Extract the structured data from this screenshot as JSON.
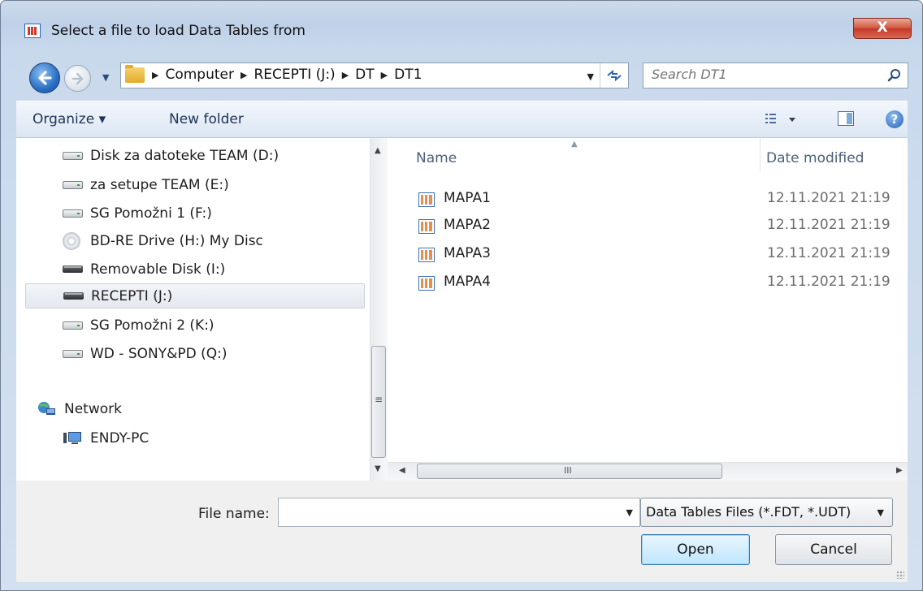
{
  "window": {
    "title": "Select a file to load Data Tables from",
    "close_label": "X"
  },
  "address": {
    "crumbs": [
      "Computer",
      "RECEPTI (J:)",
      "DT",
      "DT1"
    ]
  },
  "search": {
    "placeholder": "Search DT1"
  },
  "commands": {
    "organize": "Organize ▾",
    "new_folder": "New folder"
  },
  "nav": {
    "items": [
      {
        "label": "Disk za datoteke TEAM (D:)",
        "icon": "hard-drive-icon"
      },
      {
        "label": "za setupe TEAM (E:)",
        "icon": "hard-drive-icon"
      },
      {
        "label": "SG Pomožni 1 (F:)",
        "icon": "hard-drive-icon"
      },
      {
        "label": "BD-RE Drive (H:) My Disc",
        "icon": "disc-drive-icon"
      },
      {
        "label": "Removable Disk (I:)",
        "icon": "removable-disk-icon"
      },
      {
        "label": "RECEPTI (J:)",
        "icon": "removable-disk-icon",
        "selected": true
      },
      {
        "label": "SG Pomožni 2 (K:)",
        "icon": "hard-drive-icon"
      },
      {
        "label": "WD - SONY&PD (Q:)",
        "icon": "hard-drive-icon"
      }
    ],
    "network": {
      "label": "Network",
      "icon": "network-icon"
    },
    "computer": {
      "label": "ENDY-PC",
      "icon": "computer-icon"
    }
  },
  "files": {
    "columns": {
      "name": "Name",
      "date": "Date modified"
    },
    "rows": [
      {
        "name": "MAPA1",
        "date": "12.11.2021 21:19"
      },
      {
        "name": "MAPA2",
        "date": "12.11.2021 21:19"
      },
      {
        "name": "MAPA3",
        "date": "12.11.2021 21:19"
      },
      {
        "name": "MAPA4",
        "date": "12.11.2021 21:19"
      }
    ]
  },
  "footer": {
    "file_name_label": "File name:",
    "file_name_value": "",
    "file_type": "Data Tables Files (*.FDT, *.UDT)",
    "open_label": "Open",
    "cancel_label": "Cancel"
  },
  "scrollbar_glyphs": {
    "grip": "≡",
    "hgrip": "III"
  }
}
